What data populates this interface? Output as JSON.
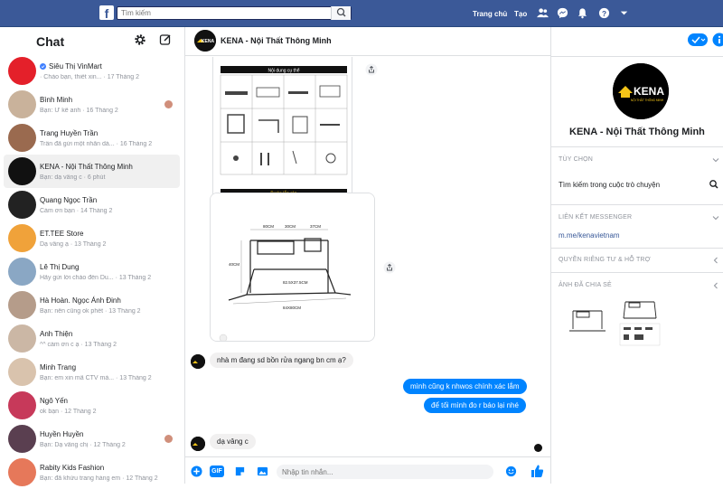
{
  "topbar": {
    "logo_letter": "f",
    "search_placeholder": "Tìm kiếm",
    "home_label": "Trang chủ",
    "create_label": "Tạo"
  },
  "sidebar": {
    "title": "Chat",
    "conversations": [
      {
        "name": "Siêu Thị VinMart",
        "snippet": "· Chào bạn, thiết xin... · 17 Tháng 2",
        "verified": true,
        "avatar_color": "#e4202a"
      },
      {
        "name": "Bình Minh",
        "snippet": "Bạn: Ừ kê anh · 16 Tháng 2",
        "avatar_color": "#c9b29b"
      },
      {
        "name": "Trang Huyền Trần",
        "snippet": "Trần đã gửi một nhãn dá... · 16 Tháng 2",
        "avatar_color": "#9a6a4f"
      },
      {
        "name": "KENA - Nội Thất Thông Minh",
        "snippet": "Bạn: dạ vâng c · 6 phút",
        "active": true,
        "avatar_color": "#111111"
      },
      {
        "name": "Quang Ngọc Trần",
        "snippet": "Cảm ơn bạn · 14 Tháng 2",
        "avatar_color": "#222222"
      },
      {
        "name": "ET.TEE Store",
        "snippet": "Dạ vâng ạ · 13 Tháng 2",
        "avatar_color": "#f0a23a"
      },
      {
        "name": "Lê Thị Dung",
        "snippet": "Hãy gửi lời chào đến Du... · 13 Tháng 2",
        "avatar_color": "#8aa7c4"
      },
      {
        "name": "Hà Hoàn. Ngọc Ánh Đinh",
        "snippet": "Bạn: nên cũng ok phết · 13 Tháng 2",
        "avatar_color": "#b59c8a"
      },
      {
        "name": "Anh Thiện",
        "snippet": "^^ cảm ơn c ạ · 13 Tháng 2",
        "avatar_color": "#cbb7a5"
      },
      {
        "name": "Minh Trang",
        "snippet": "Bạn: em xin mã CTV mà... · 13 Tháng 2",
        "avatar_color": "#d9c3ad"
      },
      {
        "name": "Ngô Yến",
        "snippet": "ok bạn · 12 Tháng 2",
        "avatar_color": "#c7395a"
      },
      {
        "name": "Huyền Huyền",
        "snippet": "Bạn: Dạ vâng chị · 12 Tháng 2",
        "avatar_color": "#5a3f50"
      },
      {
        "name": "Rabity Kids Fashion",
        "snippet": "Bạn: đã khứu trang hàng em · 12 Tháng 2",
        "avatar_color": "#e6785a"
      }
    ]
  },
  "chat": {
    "title": "KENA - Nội Thất Thông Minh",
    "image1_title": "Nội dung cụ thể",
    "image1_footer": "Bước lắp ráp",
    "image2_labels": [
      "80CM",
      "30CM",
      "37CM",
      "82.5X37.5CM",
      "84X80CM",
      "40CM"
    ],
    "messages": [
      {
        "from": "them",
        "text": "nhà m đang sd bồn rửa ngang bn cm ạ?"
      },
      {
        "from": "me",
        "text": "mình cũng k nhwos chính xác lắm"
      },
      {
        "from": "me",
        "text": "để tối mình đo r báo lại nhé"
      },
      {
        "from": "them",
        "text": "dạ vâng c"
      }
    ],
    "composer_placeholder": "Nhập tin nhắn...",
    "gif_label": "GIF"
  },
  "info": {
    "brand_logo_text": "KENA",
    "brand_tagline": "NỘI THẤT THÔNG MINH",
    "brand_name": "KENA - Nội Thất Thông Minh",
    "options_header": "TÙY CHỌN",
    "search_in_conv": "Tìm kiếm trong cuộc trò chuyện",
    "messenger_link_header": "LIÊN KẾT MESSENGER",
    "messenger_link": "m.me/kenavietnam",
    "privacy_header": "QUYỀN RIÊNG TƯ & HỖ TRỢ",
    "shared_photos_header": "ẢNH ĐÃ CHIA SẺ"
  },
  "colors": {
    "facebook_blue": "#3b5998",
    "messenger_blue": "#0084ff",
    "active_bg": "#f0f0f0"
  }
}
